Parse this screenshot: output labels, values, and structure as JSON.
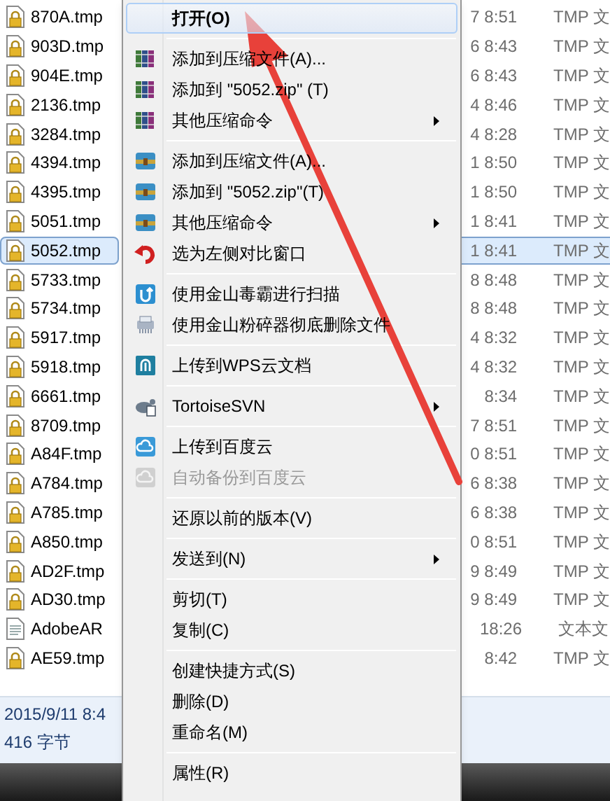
{
  "files": [
    {
      "name": "870A.tmp",
      "date": "7 8:51",
      "type": "TMP 文",
      "kind": "locked",
      "selected": false
    },
    {
      "name": "903D.tmp",
      "date": "6 8:43",
      "type": "TMP 文",
      "kind": "locked",
      "selected": false
    },
    {
      "name": "904E.tmp",
      "date": "6 8:43",
      "type": "TMP 文",
      "kind": "locked",
      "selected": false
    },
    {
      "name": "2136.tmp",
      "date": "4 8:46",
      "type": "TMP 文",
      "kind": "locked",
      "selected": false
    },
    {
      "name": "3284.tmp",
      "date": "4 8:28",
      "type": "TMP 文",
      "kind": "locked",
      "selected": false
    },
    {
      "name": "4394.tmp",
      "date": "1 8:50",
      "type": "TMP 文",
      "kind": "locked",
      "selected": false
    },
    {
      "name": "4395.tmp",
      "date": "1 8:50",
      "type": "TMP 文",
      "kind": "locked",
      "selected": false
    },
    {
      "name": "5051.tmp",
      "date": "1 8:41",
      "type": "TMP 文",
      "kind": "locked",
      "selected": false
    },
    {
      "name": "5052.tmp",
      "date": "1 8:41",
      "type": "TMP 文",
      "kind": "locked",
      "selected": true
    },
    {
      "name": "5733.tmp",
      "date": "8 8:48",
      "type": "TMP 文",
      "kind": "locked",
      "selected": false
    },
    {
      "name": "5734.tmp",
      "date": "8 8:48",
      "type": "TMP 文",
      "kind": "locked",
      "selected": false
    },
    {
      "name": "5917.tmp",
      "date": "4 8:32",
      "type": "TMP 文",
      "kind": "locked",
      "selected": false
    },
    {
      "name": "5918.tmp",
      "date": "4 8:32",
      "type": "TMP 文",
      "kind": "locked",
      "selected": false
    },
    {
      "name": "6661.tmp",
      "date": "8:34",
      "type": "TMP 文",
      "kind": "locked",
      "selected": false
    },
    {
      "name": "8709.tmp",
      "date": "7 8:51",
      "type": "TMP 文",
      "kind": "locked",
      "selected": false
    },
    {
      "name": "A84F.tmp",
      "date": "0 8:51",
      "type": "TMP 文",
      "kind": "locked",
      "selected": false
    },
    {
      "name": "A784.tmp",
      "date": "6 8:38",
      "type": "TMP 文",
      "kind": "locked",
      "selected": false
    },
    {
      "name": "A785.tmp",
      "date": "6 8:38",
      "type": "TMP 文",
      "kind": "locked",
      "selected": false
    },
    {
      "name": "A850.tmp",
      "date": "0 8:51",
      "type": "TMP 文",
      "kind": "locked",
      "selected": false
    },
    {
      "name": "AD2F.tmp",
      "date": "9 8:49",
      "type": "TMP 文",
      "kind": "locked",
      "selected": false
    },
    {
      "name": "AD30.tmp",
      "date": "9 8:49",
      "type": "TMP 文",
      "kind": "locked",
      "selected": false
    },
    {
      "name": "AdobeAR",
      "date": "18:26",
      "type": "文本文",
      "kind": "text",
      "selected": false
    },
    {
      "name": "AE59.tmp",
      "date": "8:42",
      "type": "TMP 文",
      "kind": "locked",
      "selected": false
    }
  ],
  "status_bar": {
    "date": "2015/9/11 8:4",
    "size": "416 字节"
  },
  "context_menu": [
    {
      "kind": "item",
      "label": "打开(O)",
      "submenu": false,
      "disabled": false,
      "selected": true,
      "bold": true
    },
    {
      "kind": "separator"
    },
    {
      "kind": "item",
      "label": "添加到压缩文件(A)...",
      "submenu": false,
      "disabled": false,
      "selected": false,
      "bold": false
    },
    {
      "kind": "item",
      "label": "添加到 \"5052.zip\" (T)",
      "submenu": false,
      "disabled": false,
      "selected": false,
      "bold": false
    },
    {
      "kind": "item",
      "label": "其他压缩命令",
      "submenu": true,
      "disabled": false,
      "selected": false,
      "bold": false
    },
    {
      "kind": "separator"
    },
    {
      "kind": "item",
      "label": "添加到压缩文件(A)...",
      "submenu": false,
      "disabled": false,
      "selected": false,
      "bold": false
    },
    {
      "kind": "item",
      "label": "添加到 \"5052.zip\"(T)",
      "submenu": false,
      "disabled": false,
      "selected": false,
      "bold": false
    },
    {
      "kind": "item",
      "label": "其他压缩命令",
      "submenu": true,
      "disabled": false,
      "selected": false,
      "bold": false
    },
    {
      "kind": "item",
      "label": "选为左侧对比窗口",
      "submenu": false,
      "disabled": false,
      "selected": false,
      "bold": false
    },
    {
      "kind": "separator"
    },
    {
      "kind": "item",
      "label": "使用金山毒霸进行扫描",
      "submenu": false,
      "disabled": false,
      "selected": false,
      "bold": false
    },
    {
      "kind": "item",
      "label": "使用金山粉碎器彻底删除文件",
      "submenu": false,
      "disabled": false,
      "selected": false,
      "bold": false
    },
    {
      "kind": "separator"
    },
    {
      "kind": "item",
      "label": "上传到WPS云文档",
      "submenu": false,
      "disabled": false,
      "selected": false,
      "bold": false
    },
    {
      "kind": "separator"
    },
    {
      "kind": "item",
      "label": "TortoiseSVN",
      "submenu": true,
      "disabled": false,
      "selected": false,
      "bold": false
    },
    {
      "kind": "separator"
    },
    {
      "kind": "item",
      "label": "上传到百度云",
      "submenu": false,
      "disabled": false,
      "selected": false,
      "bold": false
    },
    {
      "kind": "item",
      "label": "自动备份到百度云",
      "submenu": false,
      "disabled": true,
      "selected": false,
      "bold": false
    },
    {
      "kind": "separator"
    },
    {
      "kind": "item",
      "label": "还原以前的版本(V)",
      "submenu": false,
      "disabled": false,
      "selected": false,
      "bold": false
    },
    {
      "kind": "separator"
    },
    {
      "kind": "item",
      "label": "发送到(N)",
      "submenu": true,
      "disabled": false,
      "selected": false,
      "bold": false
    },
    {
      "kind": "separator"
    },
    {
      "kind": "item",
      "label": "剪切(T)",
      "submenu": false,
      "disabled": false,
      "selected": false,
      "bold": false
    },
    {
      "kind": "item",
      "label": "复制(C)",
      "submenu": false,
      "disabled": false,
      "selected": false,
      "bold": false
    },
    {
      "kind": "separator"
    },
    {
      "kind": "item",
      "label": "创建快捷方式(S)",
      "submenu": false,
      "disabled": false,
      "selected": false,
      "bold": false
    },
    {
      "kind": "item",
      "label": "删除(D)",
      "submenu": false,
      "disabled": false,
      "selected": false,
      "bold": false
    },
    {
      "kind": "item",
      "label": "重命名(M)",
      "submenu": false,
      "disabled": false,
      "selected": false,
      "bold": false
    },
    {
      "kind": "separator"
    },
    {
      "kind": "item",
      "label": "属性(R)",
      "submenu": false,
      "disabled": false,
      "selected": false,
      "bold": false
    }
  ],
  "annotation": {
    "kind": "arrow"
  }
}
